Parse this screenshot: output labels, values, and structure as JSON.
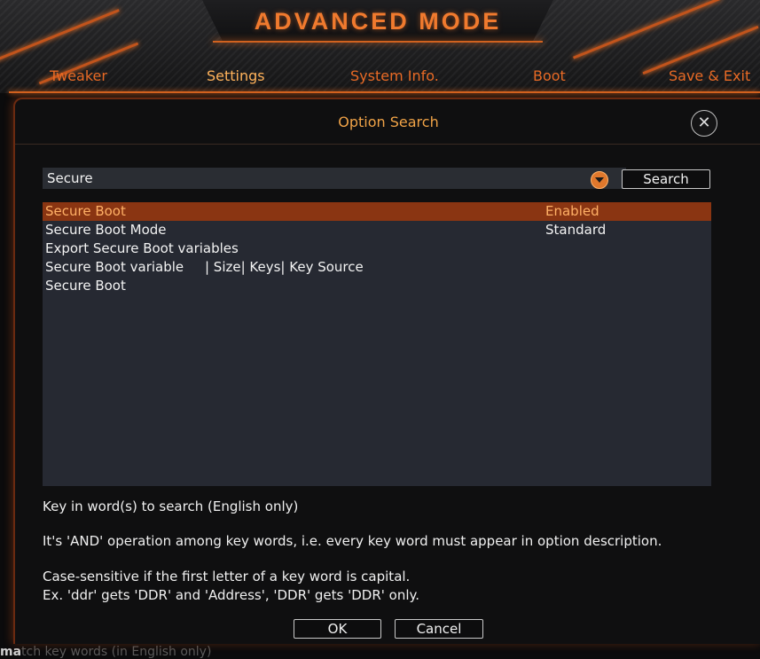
{
  "header": {
    "title": "ADVANCED MODE",
    "tabs": [
      {
        "label": "Tweaker",
        "active": false
      },
      {
        "label": "Settings",
        "active": true
      },
      {
        "label": "System Info.",
        "active": false
      },
      {
        "label": "Boot",
        "active": false
      },
      {
        "label": "Save & Exit",
        "active": false
      }
    ]
  },
  "dialog": {
    "title": "Option Search",
    "close_icon": "close-icon",
    "search": {
      "value": "Secure",
      "dropdown_icon": "chevron-down-icon",
      "button_label": "Search"
    },
    "results": [
      {
        "option": "Secure Boot",
        "value": "Enabled",
        "selected": true
      },
      {
        "option": "Secure Boot Mode",
        "value": "Standard",
        "selected": false
      },
      {
        "option": "Export Secure Boot variables",
        "value": "",
        "selected": false
      },
      {
        "option": "Secure Boot variable     | Size| Keys| Key Source",
        "value": "",
        "selected": false
      },
      {
        "option": "Secure Boot",
        "value": "",
        "selected": false
      }
    ],
    "help": {
      "line1": "Key in word(s) to search (English only)",
      "line2": "It's 'AND' operation among key words, i.e. every key word must appear in option description.",
      "line3": "Case-sensitive if the first letter of a key word is capital.",
      "line4": "Ex. 'ddr' gets 'DDR' and 'Address', 'DDR' gets 'DDR' only."
    },
    "ok_label": "OK",
    "cancel_label": "Cancel"
  },
  "background_hint": {
    "prefix": "ma",
    "rest": "tch key words (in English only)"
  },
  "colors": {
    "accent": "#e86a25",
    "selected_row": "#8a3512",
    "list_bg": "#262932"
  }
}
